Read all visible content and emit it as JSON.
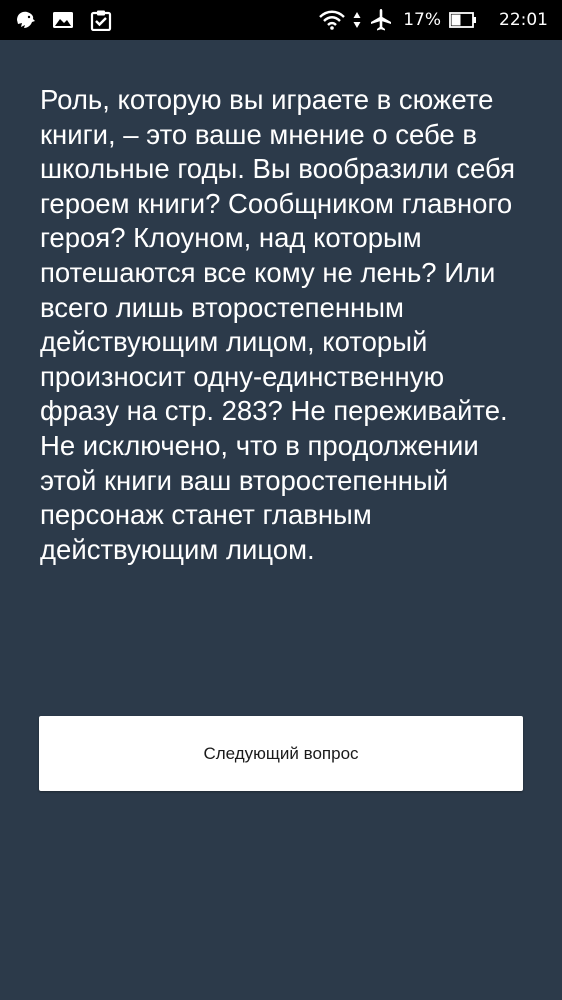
{
  "status_bar": {
    "left_icons": [
      "leo-icon",
      "image-icon",
      "clipboard-check-icon"
    ],
    "right_icons": [
      "wifi-icon",
      "data-arrows-icon",
      "airplane-icon",
      "battery-icon"
    ],
    "battery_percent": "17%",
    "time": "22:01"
  },
  "main": {
    "text": "Роль, которую вы играете в сюжете книги, – это ваше мнение о себе в школьные годы. Вы вообразили себя героем книги? Сообщником главного героя? Клоуном, над которым потешаются все кому не лень? Или всего лишь второстепенным действующим лицом, который произносит одну-единственную фразу на стр. 283? Не переживайте. Не исключено, что в продолжении этой книги ваш второстепенный персонаж станет главным действующим лицом.",
    "next_button_label": "Следующий вопрос"
  },
  "colors": {
    "background": "#2c3a4a",
    "status_bar": "#000000",
    "button": "#ffffff"
  }
}
